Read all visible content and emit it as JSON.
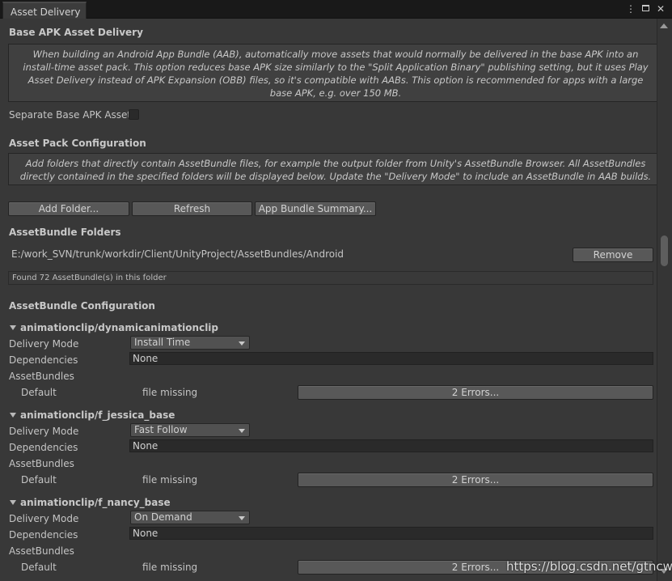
{
  "window": {
    "tab_title": "Asset Delivery",
    "menu_icon": "kebab-menu-icon",
    "maximize_icon": "maximize-icon",
    "close_icon": "close-icon"
  },
  "base_apk": {
    "header": "Base APK Asset Delivery",
    "help_text": "When building an Android App Bundle (AAB), automatically move assets that would normally be delivered in the base APK into an install-time asset pack. This option reduces base APK size similarly to the \"Split Application Binary\" publishing setting, but it uses Play Asset Delivery instead of APK Expansion (OBB) files, so it's compatible with AABs. This option is recommended for apps with a large base APK, e.g. over 150 MB.",
    "separate_label": "Separate Base APK Asset",
    "separate_checked": false
  },
  "asset_pack": {
    "header": "Asset Pack Configuration",
    "help_text": "Add folders that directly contain AssetBundle files, for example the output folder from Unity's AssetBundle Browser. All AssetBundles directly contained in the specified folders will be displayed below. Update the \"Delivery Mode\" to include an AssetBundle in AAB builds.",
    "buttons": {
      "add_folder": "Add Folder...",
      "refresh": "Refresh",
      "summary": "App Bundle Summary..."
    }
  },
  "folders": {
    "header": "AssetBundle Folders",
    "path": "E:/work_SVN/trunk/workdir/Client/UnityProject/AssetBundles/Android",
    "remove_label": "Remove",
    "found_text": "Found 72 AssetBundle(s) in this folder"
  },
  "config": {
    "header": "AssetBundle Configuration",
    "delivery_label": "Delivery Mode",
    "dependencies_label": "Dependencies",
    "assetbundles_label": "AssetBundles",
    "bundles": [
      {
        "name": "animationclip/dynamicanimationclip",
        "delivery_mode": "Install Time",
        "dependencies": "None",
        "row_label": "Default",
        "status": "file missing",
        "errors_label": "2 Errors..."
      },
      {
        "name": "animationclip/f_jessica_base",
        "delivery_mode": "Fast Follow",
        "dependencies": "None",
        "row_label": "Default",
        "status": "file missing",
        "errors_label": "2 Errors..."
      },
      {
        "name": "animationclip/f_nancy_base",
        "delivery_mode": "On Demand",
        "dependencies": "None",
        "row_label": "Default",
        "status": "file missing",
        "errors_label": "2 Errors..."
      }
    ]
  },
  "watermark": "https://blog.csdn.net/gtncwy"
}
